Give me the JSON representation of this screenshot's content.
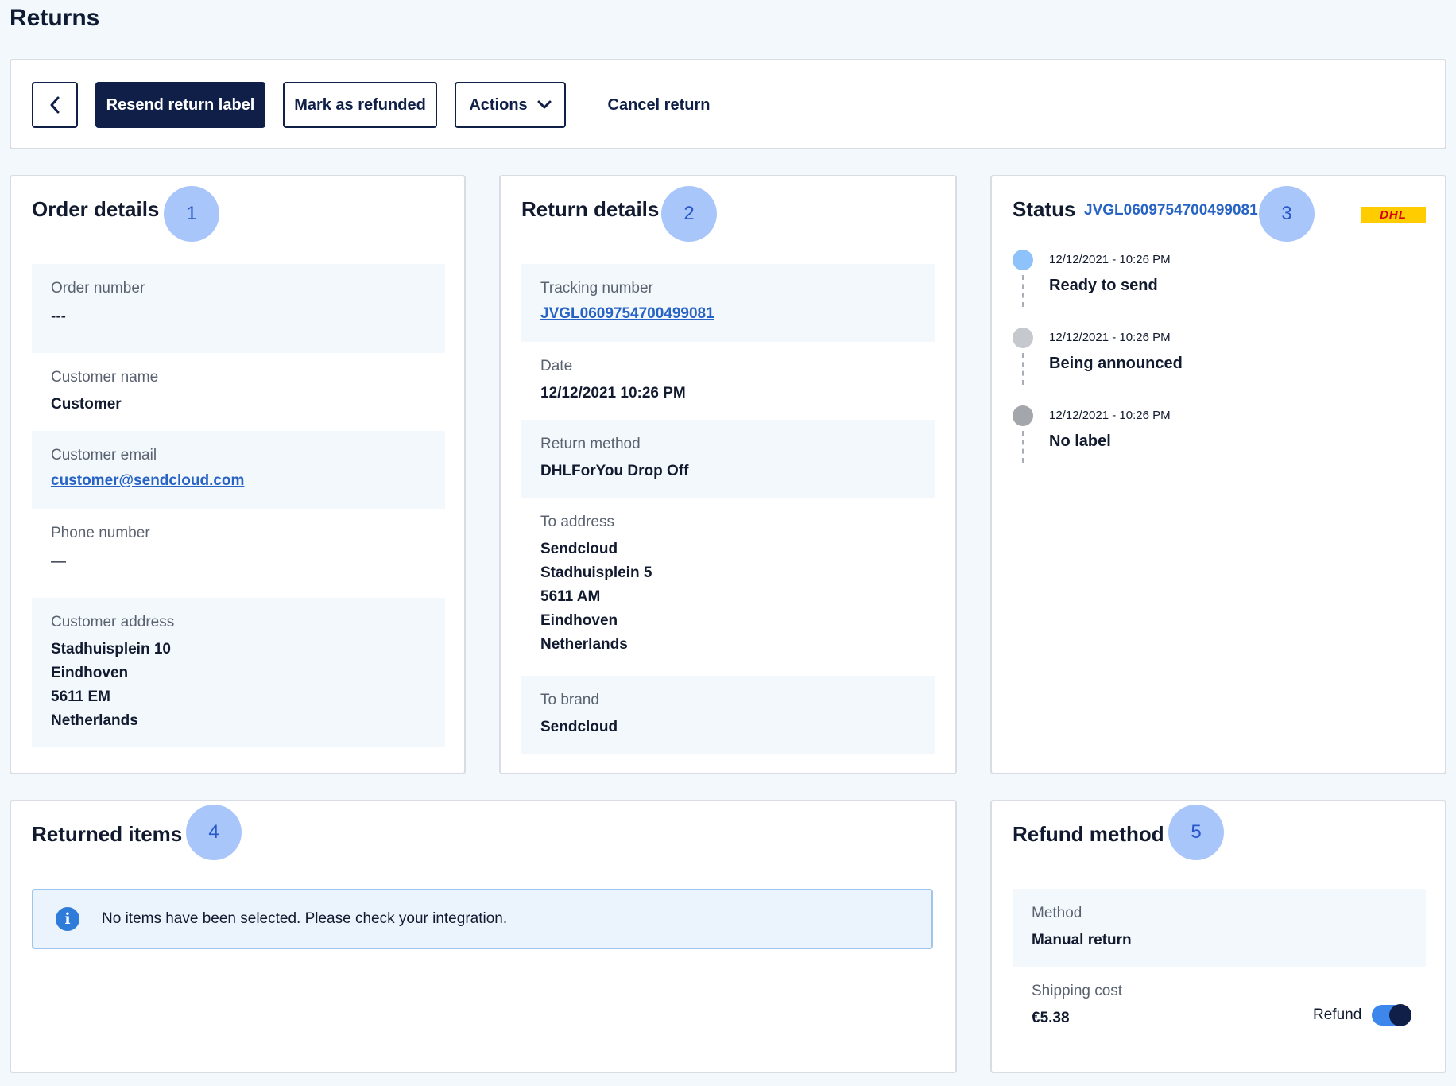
{
  "page": {
    "title": "Returns"
  },
  "toolbar": {
    "resend_label": "Resend return label",
    "refunded_label": "Mark as refunded",
    "actions_label": "Actions",
    "cancel_label": "Cancel return"
  },
  "order_details": {
    "title": "Order details",
    "badge": "1",
    "order_number_label": "Order number",
    "order_number_value": "---",
    "customer_name_label": "Customer name",
    "customer_name_value": "Customer",
    "customer_email_label": "Customer email",
    "customer_email_value": "customer@sendcloud.com",
    "phone_label": "Phone number",
    "phone_value": "—",
    "address_label": "Customer address",
    "address_lines": [
      "Stadhuisplein 10",
      "Eindhoven",
      "5611 EM",
      "Netherlands"
    ]
  },
  "return_details": {
    "title": "Return details",
    "badge": "2",
    "tracking_label": "Tracking number",
    "tracking_value": "JVGL0609754700499081",
    "date_label": "Date",
    "date_value": "12/12/2021 10:26 PM",
    "method_label": "Return method",
    "method_value": "DHLForYou Drop Off",
    "to_address_label": "To address",
    "to_address_lines": [
      "Sendcloud",
      "Stadhuisplein 5",
      "5611 AM",
      "Eindhoven",
      "Netherlands"
    ],
    "to_brand_label": "To brand",
    "to_brand_value": "Sendcloud"
  },
  "status": {
    "title": "Status",
    "tracking": "JVGL0609754700499081",
    "badge": "3",
    "carrier_logo_text": "DHL",
    "events": [
      {
        "date": "12/12/2021 - 10:26 PM",
        "label": "Ready to send",
        "color": "#8ec2fb"
      },
      {
        "date": "12/12/2021 - 10:26 PM",
        "label": "Being announced",
        "color": "#c5c8cd"
      },
      {
        "date": "12/12/2021 - 10:26 PM",
        "label": "No label",
        "color": "#a3a6ab"
      }
    ]
  },
  "returned_items": {
    "title": "Returned items",
    "badge": "4",
    "info_message": "No items have been selected. Please check your integration."
  },
  "refund_method": {
    "title": "Refund method",
    "badge": "5",
    "method_label": "Method",
    "method_value": "Manual return",
    "shipping_cost_label": "Shipping cost",
    "shipping_cost_value": "€5.38",
    "refund_toggle_label": "Refund",
    "refund_toggle_on": true
  },
  "colors": {
    "primary": "#0f1f47",
    "link": "#2763c4",
    "badge": "#a9c6fb",
    "page_bg": "#f3f8fc"
  }
}
